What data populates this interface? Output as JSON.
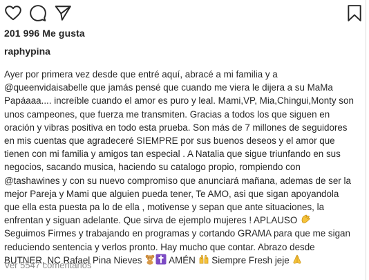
{
  "post": {
    "likes_text": "201 996 Me gusta",
    "author": "raphypina",
    "caption_lines": [
      "Ayer por primera vez desde que entré aquí, abracé a mi familia y a",
      "@queenvidaisabelle que jamás pensé que cuando me viera  le dijera a su MaMa",
      "Papáaaa.... increíble cuando el amor es puro y leal. Mami,VP, Mia,Chingui,Monty son",
      "unos campeones, que fuerza me transmiten.  Gracias a todos los que siguen en",
      "oración y vibras positiva en todo esta prueba. Son más de 7 millones de seguidores",
      "en mis cuentas que agradeceré SIEMPRE por sus buenos deseos y el amor que",
      "tienen con mi familia y amigos tan especial . A Natalia que sigue triunfando en sus",
      "negocios, sacando musica, haciendo su catalogo propio, rompiendo con",
      "@tashawines y con su nuevo compromiso que anunciará mañana, ademas de ser la",
      "mejor Pareja y Mami que alguien pueda tener, Te AMO, asi que sigan apoyandola",
      "que ella esta puesta pa lo de ella , motivense y sepan que ante situaciones, la",
      "enfrentan y  siguan adelante. Que sirva de ejemplo mujeres ! APLAUSO",
      "Seguimos Firmes y trabajando en programas y cortando GRAMA para que me sigan",
      "reduciendo sentencia y  verlos pronto. Hay mucho que contar. Abrazo desde",
      "BUTNER, NC Rafael Pina Nieves",
      " AMÉN ",
      " Siempre Fresh jeje "
    ],
    "comments_link": "Ver 5547 comentarios"
  },
  "icons": {
    "like": "heart-icon",
    "comment": "comment-icon",
    "share": "share-icon",
    "save": "bookmark-icon",
    "clap": "clapping-hands-emoji",
    "bear": "teddy-bear-emoji",
    "cross": "latin-cross-emoji",
    "raised_hands": "raised-hands-emoji",
    "pray": "folded-hands-emoji"
  },
  "colors": {
    "text": "#262626",
    "muted": "#8e8e8e",
    "border": "#dbdbdb",
    "emoji_yellow": "#f5c33b",
    "emoji_purple": "#7d4cc4"
  }
}
